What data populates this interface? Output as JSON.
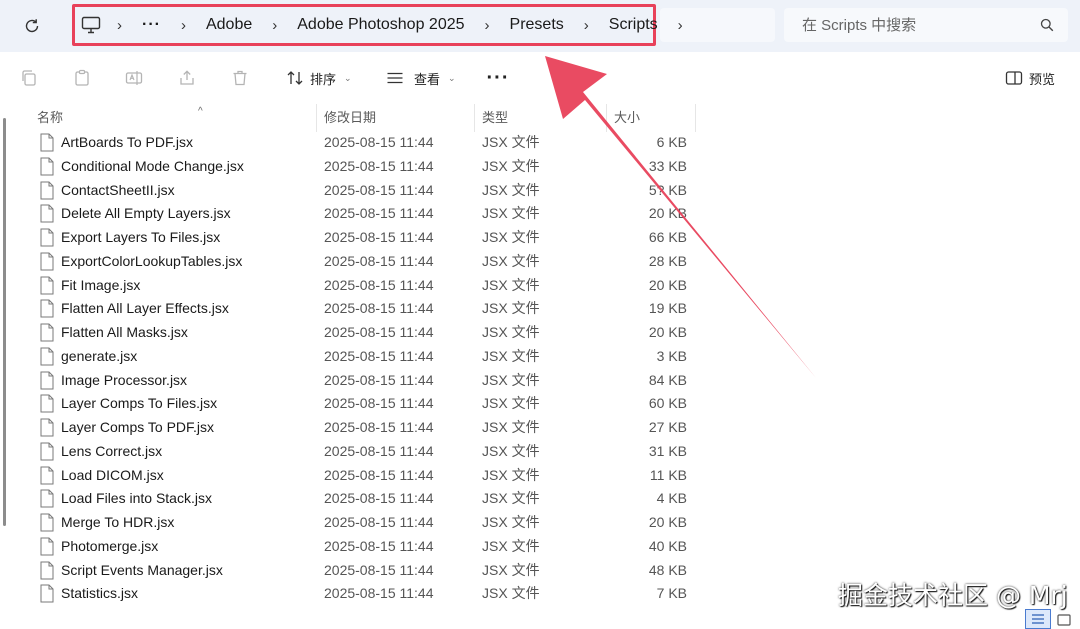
{
  "address_bar": {
    "crumbs": [
      "Adobe",
      "Adobe Photoshop 2025",
      "Presets",
      "Scripts"
    ],
    "overflow": "···"
  },
  "search": {
    "placeholder": "在 Scripts 中搜索"
  },
  "toolbar": {
    "sort_label": "排序",
    "view_label": "查看",
    "more_label": "···",
    "preview_label": "预览"
  },
  "columns": {
    "name": "名称",
    "date": "修改日期",
    "type": "类型",
    "size": "大小"
  },
  "files": [
    {
      "name": "ArtBoards To PDF.jsx",
      "date": "2025-08-15 11:44",
      "type": "JSX 文件",
      "size": "6 KB"
    },
    {
      "name": "Conditional Mode Change.jsx",
      "date": "2025-08-15 11:44",
      "type": "JSX 文件",
      "size": "33 KB"
    },
    {
      "name": "ContactSheetII.jsx",
      "date": "2025-08-15 11:44",
      "type": "JSX 文件",
      "size": "5? KB"
    },
    {
      "name": "Delete All Empty Layers.jsx",
      "date": "2025-08-15 11:44",
      "type": "JSX 文件",
      "size": "20 KB"
    },
    {
      "name": "Export Layers To Files.jsx",
      "date": "2025-08-15 11:44",
      "type": "JSX 文件",
      "size": "66 KB"
    },
    {
      "name": "ExportColorLookupTables.jsx",
      "date": "2025-08-15 11:44",
      "type": "JSX 文件",
      "size": "28 KB"
    },
    {
      "name": "Fit Image.jsx",
      "date": "2025-08-15 11:44",
      "type": "JSX 文件",
      "size": "20 KB"
    },
    {
      "name": "Flatten All Layer Effects.jsx",
      "date": "2025-08-15 11:44",
      "type": "JSX 文件",
      "size": "19 KB"
    },
    {
      "name": "Flatten All Masks.jsx",
      "date": "2025-08-15 11:44",
      "type": "JSX 文件",
      "size": "20 KB"
    },
    {
      "name": "generate.jsx",
      "date": "2025-08-15 11:44",
      "type": "JSX 文件",
      "size": "3 KB"
    },
    {
      "name": "Image Processor.jsx",
      "date": "2025-08-15 11:44",
      "type": "JSX 文件",
      "size": "84 KB"
    },
    {
      "name": "Layer Comps To Files.jsx",
      "date": "2025-08-15 11:44",
      "type": "JSX 文件",
      "size": "60 KB"
    },
    {
      "name": "Layer Comps To PDF.jsx",
      "date": "2025-08-15 11:44",
      "type": "JSX 文件",
      "size": "27 KB"
    },
    {
      "name": "Lens Correct.jsx",
      "date": "2025-08-15 11:44",
      "type": "JSX 文件",
      "size": "31 KB"
    },
    {
      "name": "Load DICOM.jsx",
      "date": "2025-08-15 11:44",
      "type": "JSX 文件",
      "size": "11 KB"
    },
    {
      "name": "Load Files into Stack.jsx",
      "date": "2025-08-15 11:44",
      "type": "JSX 文件",
      "size": "4 KB"
    },
    {
      "name": "Merge To HDR.jsx",
      "date": "2025-08-15 11:44",
      "type": "JSX 文件",
      "size": "20 KB"
    },
    {
      "name": "Photomerge.jsx",
      "date": "2025-08-15 11:44",
      "type": "JSX 文件",
      "size": "40 KB"
    },
    {
      "name": "Script Events Manager.jsx",
      "date": "2025-08-15 11:44",
      "type": "JSX 文件",
      "size": "48 KB"
    },
    {
      "name": "Statistics.jsx",
      "date": "2025-08-15 11:44",
      "type": "JSX 文件",
      "size": "7 KB"
    }
  ],
  "watermark": "掘金技术社区 @ Mrj",
  "icons": {
    "refresh": "refresh-icon",
    "computer": "computer-icon",
    "search": "search-icon",
    "copy": "copy-icon",
    "paste": "paste-icon",
    "rename": "rename-icon",
    "share": "share-icon",
    "delete": "trash-icon",
    "sort": "sort-icon",
    "view": "view-list-icon",
    "preview": "preview-pane-icon",
    "file": "file-icon"
  },
  "colors": {
    "highlight": "#e8415a",
    "address_bg": "#eef2f9"
  }
}
